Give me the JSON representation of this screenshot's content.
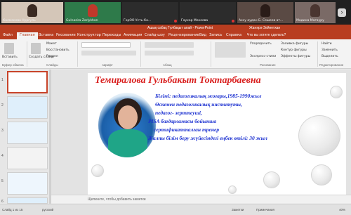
{
  "participants": [
    {
      "name": "Калмакова Нургуль",
      "bg": "#d4c6b8",
      "av": "#3a2a22"
    },
    {
      "name": "Gulnazira Zarlykhan",
      "bg": "#2e7a4a",
      "av": "#c0392b"
    },
    {
      "name": "ГорОО Усть-Ка...",
      "bg": "#2c2c2c",
      "av": ""
    },
    {
      "name": "Гаухар Мекеева",
      "bg": "#2c2c2c",
      "av": ""
    },
    {
      "name": "Аксу аудан Б. Сешеев ат...",
      "bg": "#5a4a44",
      "av": "#2a1c18"
    },
    {
      "name": "Мадина Магауру",
      "bg": "#7a6a66",
      "av": "#4a3530"
    }
  ],
  "window": {
    "title": "Ашық сабақ Гүлбақыт апай  -  PowerPoint",
    "user": "Жанәрә Зейнетхан"
  },
  "tabs": [
    "Файл",
    "Главная",
    "Вставка",
    "Рисование",
    "Конструктор",
    "Переходы",
    "Анимация",
    "Слайд-шоу",
    "Рецензирование",
    "Вид",
    "Запись",
    "Справка",
    "Что вы хотите сделать?"
  ],
  "ribbon": {
    "paste": "Вставить",
    "create": "Создать слайд",
    "layout": "Макет",
    "restore": "Восстановить",
    "section": "Раздел",
    "group_clip": "Буфер обмена",
    "group_slides": "Слайды",
    "group_font": "Шрифт",
    "group_para": "Абзац",
    "group_draw": "Рисование",
    "group_edit": "Редактирование",
    "find": "Найти",
    "replace": "Заменить",
    "select": "Выделить",
    "fill": "Заливка фигуры",
    "outline": "Контур фигуры",
    "effects": "Эффекты фигуры",
    "arrange": "Упорядочить",
    "styles": "Экспресс-стили"
  },
  "thumb_numbers": [
    "1",
    "2",
    "3",
    "4",
    "5",
    "6"
  ],
  "slide": {
    "title": "Темиралова Гульбакыт Токтарбаевна",
    "lines": [
      "Білімі: педагогикалық жоғары,1985-1990жыл",
      "Өскемен педагогикалық институты,",
      "педагог- зерттеуші,",
      "PISA бағдарламасы бойынша",
      "сертификатталған тренер",
      "Жалпы білім беру жүйесіндегі еңбек өтілі: 30 жыл"
    ]
  },
  "notes": "Щелкните, чтобы добавить заметки",
  "status": {
    "slide": "Слайд 1 из 15",
    "lang": "русский",
    "notes": "Заметки",
    "comments": "Примечания",
    "zoom": "40%"
  },
  "accent": "#b83d20"
}
